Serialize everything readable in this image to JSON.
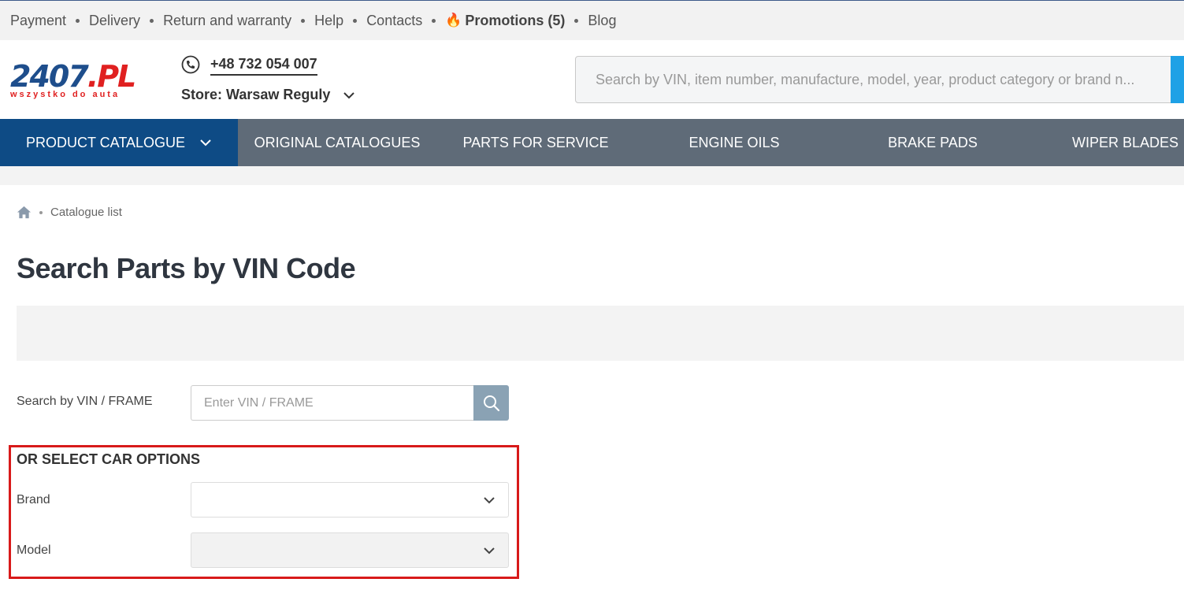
{
  "topbar": {
    "links": [
      "Payment",
      "Delivery",
      "Return and warranty",
      "Help",
      "Contacts"
    ],
    "promo": "Promotions (5)",
    "blog": "Blog"
  },
  "header": {
    "logo_main": "2407",
    "logo_suffix": ".PL",
    "logo_tagline": "wszystko do auta",
    "phone": "+48 732 054 007",
    "store": "Store: Warsaw Reguly",
    "search_placeholder": "Search by VIN, item number, manufacture, model, year, product category or brand n..."
  },
  "nav": {
    "items": [
      "PRODUCT CATALOGUE",
      "ORIGINAL CATALOGUES",
      "PARTS FOR SERVICE",
      "ENGINE OILS",
      "BRAKE PADS",
      "WIPER BLADES"
    ]
  },
  "breadcrumb": {
    "current": "Catalogue list"
  },
  "main": {
    "title": "Search Parts by VIN Code",
    "vin_label": "Search by VIN / FRAME",
    "vin_placeholder": "Enter VIN / FRAME",
    "options_title": "OR SELECT CAR OPTIONS",
    "brand_label": "Brand",
    "brand_value": "",
    "model_label": "Model",
    "model_value": ""
  },
  "colors": {
    "nav_bg": "#5f6b78",
    "nav_active": "#0e4b85",
    "highlight": "#d81a1a",
    "search_button": "#1ea1e6",
    "vin_button": "#8aa2b4"
  }
}
